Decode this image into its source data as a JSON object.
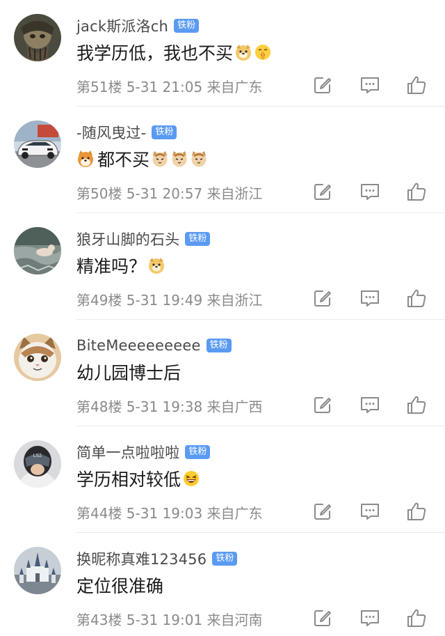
{
  "badge_text": "铁粉",
  "comments": [
    {
      "username": "jack斯派洛ch",
      "content": "我学历低，我也不买",
      "emojis": [
        "doge-emoji",
        "shush-emoji"
      ],
      "meta": "第51楼 5-31 21:05 来自广东",
      "avatar": "pirate-avatar"
    },
    {
      "username": "-随风曳过-",
      "content": "都不买",
      "lead_emoji": "shiba-emoji",
      "emojis": [
        "cat-emoji",
        "cat-emoji",
        "cat-emoji"
      ],
      "meta": "第50楼 5-31 20:57 来自浙江",
      "avatar": "car-avatar"
    },
    {
      "username": "狼牙山脚的石头",
      "content": "精准吗？",
      "emojis": [
        "doge-emoji"
      ],
      "meta": "第49楼 5-31 19:49 来自浙江",
      "avatar": "river-avatar"
    },
    {
      "username": "BiteMeeeeeeeee",
      "content": "幼儿园博士后",
      "emojis": [],
      "meta": "第48楼 5-31 19:38 来自广西",
      "avatar": "cat-avatar"
    },
    {
      "username": "简单一点啦啦啦",
      "content": "学历相对较低",
      "emojis": [
        "laughing-emoji"
      ],
      "meta": "第44楼 5-31 19:03 来自广东",
      "avatar": "helmet-avatar"
    },
    {
      "username": "换昵称真难123456",
      "content": "定位很准确",
      "emojis": [],
      "meta": "第43楼 5-31 19:01 来自河南",
      "avatar": "castle-avatar"
    }
  ],
  "icons": {
    "edit": "edit-icon",
    "reply": "comment-icon",
    "like": "thumbs-up-icon"
  },
  "colors": {
    "badge": "#5a9af2",
    "meta": "#8a8a8a",
    "username": "#4a4a4a"
  }
}
